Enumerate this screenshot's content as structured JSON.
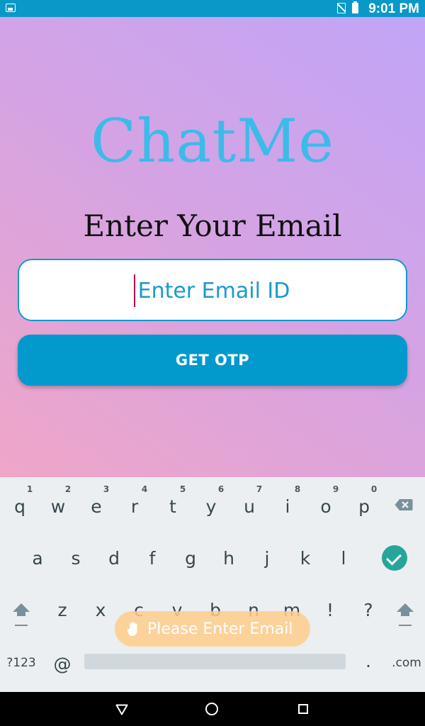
{
  "status_bar": {
    "time": "9:01 PM"
  },
  "app": {
    "title": "ChatMe",
    "heading": "Enter Your Email"
  },
  "form": {
    "email_placeholder": "Enter Email ID",
    "email_value": "",
    "submit_label": "GET OTP"
  },
  "colors": {
    "title": "#3cbbe8",
    "button": "#0299cc",
    "input_border": "#1199cc",
    "status_bar": "#0899c9"
  },
  "keyboard": {
    "row1": [
      "q",
      "w",
      "e",
      "r",
      "t",
      "y",
      "u",
      "i",
      "o",
      "p"
    ],
    "row1_hints": [
      "1",
      "2",
      "3",
      "4",
      "5",
      "6",
      "7",
      "8",
      "9",
      "0"
    ],
    "row2": [
      "a",
      "s",
      "d",
      "f",
      "g",
      "h",
      "j",
      "k",
      "l"
    ],
    "row3": [
      "z",
      "x",
      "c",
      "v",
      "b",
      "n",
      "m",
      "!",
      "?"
    ],
    "symbols_key": "?123",
    "at_key": "@",
    "period_key": ".",
    "dotcom_key": ".com"
  },
  "toast": {
    "message": "Please Enter Email"
  },
  "icons": [
    "image-icon",
    "no-sim-icon",
    "battery-icon",
    "backspace-icon",
    "done-icon",
    "shift-icon",
    "hand-icon",
    "back-icon",
    "home-icon",
    "recents-icon"
  ]
}
